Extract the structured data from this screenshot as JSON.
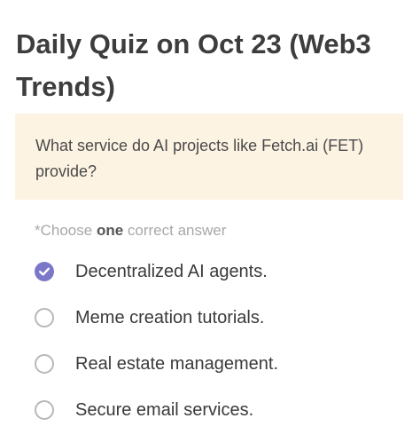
{
  "quiz": {
    "title": "Daily Quiz on Oct 23 (Web3 Trends)",
    "question": "What service do AI projects like Fetch.ai (FET) provide?",
    "hint_prefix": "*Choose ",
    "hint_emphasis": "one",
    "hint_suffix": " correct answer",
    "options": [
      {
        "label": "Decentralized AI agents.",
        "selected": true
      },
      {
        "label": "Meme creation tutorials.",
        "selected": false
      },
      {
        "label": "Real estate management.",
        "selected": false
      },
      {
        "label": "Secure email services.",
        "selected": false
      }
    ],
    "accent_color": "#7b78c9",
    "question_bg": "#fdf3e3"
  },
  "icons": {
    "selected": "check-circle-icon",
    "unselected": "radio-empty-icon"
  }
}
